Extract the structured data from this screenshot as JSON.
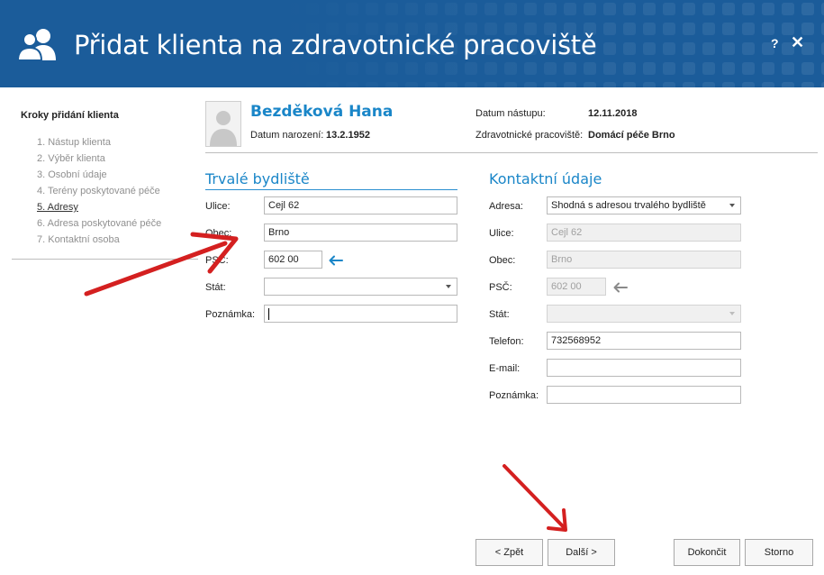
{
  "window": {
    "title": "Přidat klienta na zdravotnické pracoviště",
    "help_label": "?",
    "close_label": "✕"
  },
  "steps": {
    "title": "Kroky přidání klienta",
    "items": [
      "1. Nástup klienta",
      "2. Výběr klienta",
      "3. Osobní údaje",
      "4. Terény poskytované péče",
      "5. Adresy",
      "6. Adresa poskytované péče",
      "7. Kontaktní osoba"
    ],
    "active_index": 4
  },
  "client": {
    "name": "Bezděková Hana",
    "birth_label": "Datum narození:",
    "birth_value": "13.2.1952",
    "start_label": "Datum nástupu:",
    "start_value": "12.11.2018",
    "workplace_label": "Zdravotnické pracoviště:",
    "workplace_value": "Domácí péče Brno"
  },
  "permanent": {
    "title": "Trvalé bydliště",
    "street_label": "Ulice:",
    "street_value": "Cejl 62",
    "city_label": "Obec:",
    "city_value": "Brno",
    "zip_label": "PSČ:",
    "zip_value": "602 00",
    "country_label": "Stát:",
    "country_value": "",
    "note_label": "Poznámka:",
    "note_value": ""
  },
  "contact": {
    "title": "Kontaktní údaje",
    "address_label": "Adresa:",
    "address_value": "Shodná s adresou trvalého bydliště",
    "street_label": "Ulice:",
    "street_value": "Cejl 62",
    "city_label": "Obec:",
    "city_value": "Brno",
    "zip_label": "PSČ:",
    "zip_value": "602 00",
    "country_label": "Stát:",
    "country_value": "",
    "phone_label": "Telefon:",
    "phone_value": "732568952",
    "email_label": "E-mail:",
    "email_value": "",
    "note_label": "Poznámka:",
    "note_value": ""
  },
  "buttons": {
    "back": "< Zpět",
    "next": "Další >",
    "finish": "Dokončit",
    "cancel": "Storno"
  },
  "colors": {
    "header_bg": "#1b5c9a",
    "accent": "#1a86c8",
    "annotation_arrow": "#d42020"
  }
}
